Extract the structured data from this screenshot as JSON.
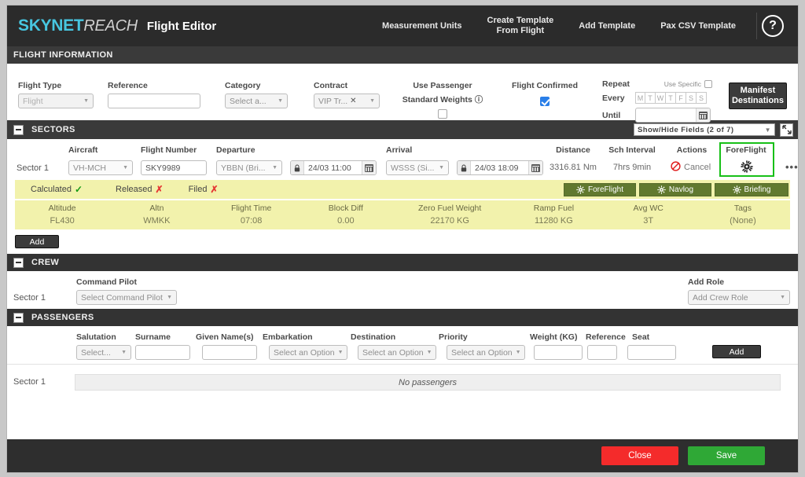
{
  "header": {
    "logo_main": "SKYNET",
    "logo_sub": "REACH",
    "app_title": "Flight Editor",
    "nav": [
      {
        "label": "Measurement Units",
        "name": "measurement-units"
      },
      {
        "label": "Create Template\nFrom Flight",
        "line1": "Create Template",
        "line2": "From Flight",
        "name": "create-template-from-flight"
      },
      {
        "label": "Add Template",
        "name": "add-template"
      },
      {
        "label": "Pax CSV Template",
        "name": "pax-csv-template"
      }
    ],
    "help_glyph": "?"
  },
  "flight_information": {
    "section_title": "FLIGHT INFORMATION",
    "flight_type": {
      "label": "Flight Type",
      "value": "Flight"
    },
    "reference": {
      "label": "Reference",
      "value": "",
      "placeholder": ""
    },
    "category": {
      "label": "Category",
      "value": "Select a..."
    },
    "contract": {
      "label": "Contract",
      "value": "VIP Tr...",
      "clear": "✕"
    },
    "use_passenger_standard_weights": {
      "label_line1": "Use Passenger",
      "label_line2": "Standard Weights",
      "info_glyph": "ⓘ",
      "checked": false
    },
    "flight_confirmed": {
      "label": "Flight Confirmed",
      "checked": true
    },
    "repeat": {
      "label": "Repeat",
      "use_specific_label": "Use Specific",
      "use_specific_checked": false,
      "every_label": "Every",
      "days": [
        "M",
        "T",
        "W",
        "T",
        "F",
        "S",
        "S"
      ],
      "until_label": "Until",
      "until_value": ""
    },
    "manifest_destinations": {
      "line1": "Manifest",
      "line2": "Destinations"
    }
  },
  "sectors": {
    "section_title": "SECTORS",
    "show_hide_fields": "Show/Hide Fields (2 of 7)",
    "columns": [
      "Aircraft",
      "Flight Number",
      "Departure",
      "Arrival",
      "Distance",
      "Sch Interval",
      "Actions",
      "ForeFlight"
    ],
    "row": {
      "sector_label": "Sector 1",
      "aircraft": "VH-MCH",
      "flight_number": "SKY9989",
      "departure": "YBBN (Bri...",
      "departure_time": "24/03 11:00",
      "arrival": "WSSS (Si...",
      "arrival_time": "24/03 18:09",
      "distance": "3316.81 Nm",
      "sch_interval": "7hrs 9min",
      "action_cancel": "Cancel",
      "foreflight_icon": "gear-icon",
      "more_menu": "•••"
    },
    "status": {
      "calculated_label": "Calculated",
      "calculated_mark": "✓",
      "released_label": "Released",
      "released_mark": "✗",
      "filed_label": "Filed",
      "filed_mark": "✗"
    },
    "status_buttons": [
      {
        "label": "ForeFlight",
        "name": "foreflight-button"
      },
      {
        "label": "Navlog",
        "name": "navlog-button"
      },
      {
        "label": "Briefing",
        "name": "briefing-button"
      }
    ],
    "detail_columns": [
      "Altitude",
      "Altn",
      "Flight Time",
      "Block Diff",
      "Zero Fuel Weight",
      "Ramp Fuel",
      "Avg WC",
      "Tags"
    ],
    "detail_values": [
      "FL430",
      "WMKK",
      "07:08",
      "0.00",
      "22170 KG",
      "11280 KG",
      "3T",
      "(None)"
    ],
    "add_label": "Add"
  },
  "crew": {
    "section_title": "CREW",
    "sector_label": "Sector 1",
    "command_pilot_label": "Command Pilot",
    "command_pilot_value": "Select Command Pilot",
    "add_role_label": "Add Role",
    "add_role_value": "Add Crew Role"
  },
  "passengers": {
    "section_title": "PASSENGERS",
    "sector_label": "Sector 1",
    "columns": [
      "Salutation",
      "Surname",
      "Given Name(s)",
      "Embarkation",
      "Destination",
      "Priority",
      "Weight (KG)",
      "Reference",
      "Seat"
    ],
    "salutation_value": "Select...",
    "surname_value": "",
    "given_names_value": "",
    "embarkation_value": "Select an Option",
    "destination_value": "Select an Option",
    "priority_value": "Select an Option",
    "weight_value": "",
    "reference_value": "",
    "seat_value": "",
    "add_label": "Add",
    "empty_message": "No passengers"
  },
  "footer": {
    "close_label": "Close",
    "save_label": "Save"
  },
  "colors": {
    "brand_cyan": "#47c6e0",
    "topbar": "#2b2b2b",
    "yellow_band": "#f2f2ac",
    "olive_button": "#61792f",
    "accent_blue": "#2a7fe8",
    "highlight_green": "#18c018",
    "close_red": "#f42b2b",
    "save_green": "#2fa836"
  }
}
